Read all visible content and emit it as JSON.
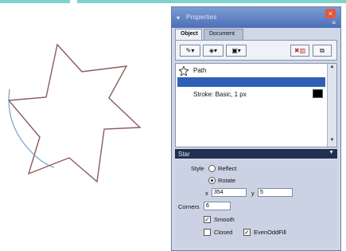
{
  "panel": {
    "title": "Properties",
    "tabs": [
      "Object",
      "Document"
    ],
    "path_label": "Path",
    "stroke_label": "Stroke: Basic, 1 px",
    "section": "Star",
    "style_label": "Style",
    "radio_reflect": "Reflect",
    "radio_rotate": "Rotate",
    "x_label": "x",
    "x_value": "354",
    "y_label": "y",
    "y_value": "5",
    "corners_label": "Corners",
    "corners_value": "6",
    "check_smooth": "Smooth",
    "check_closed": "Closed",
    "check_even_odd": "EvenOddFill"
  },
  "colors": {
    "titlebar": "#4c6fb6",
    "selection": "#2f5fb8",
    "star_stroke": "#8b5a5e",
    "panel_bg": "#cfd8e8"
  },
  "icons": [
    "path-icon",
    "close-icon",
    "delete-icon",
    "duplicate-icon"
  ]
}
